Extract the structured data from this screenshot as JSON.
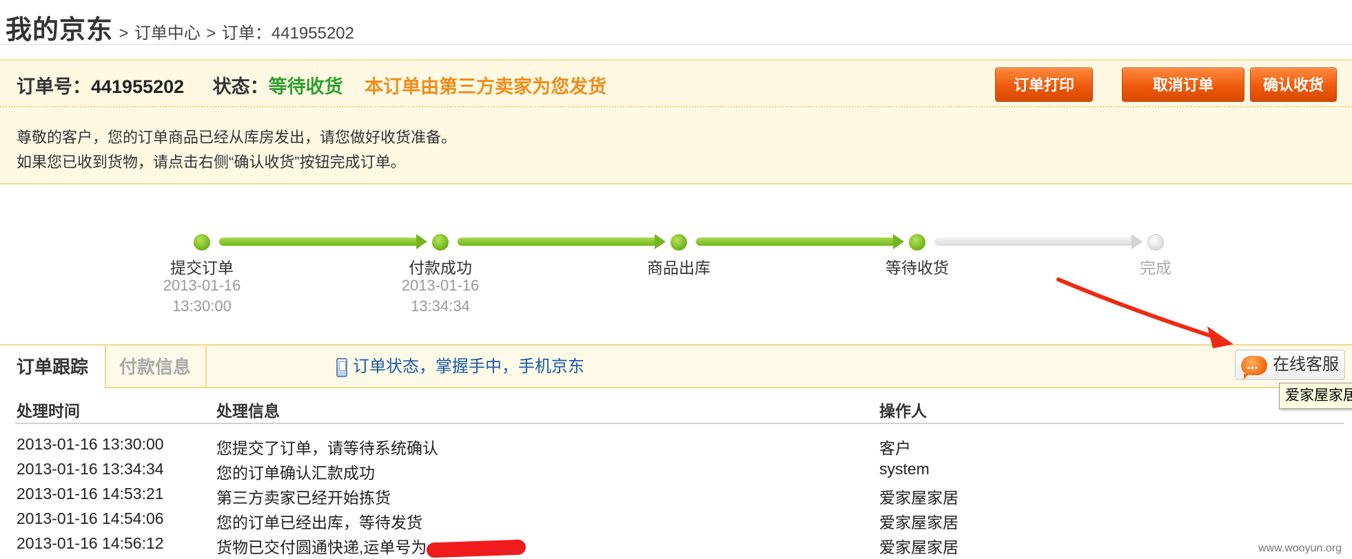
{
  "breadcrumb": {
    "home": "我的京东",
    "separator": ">",
    "level1": "订单中心",
    "level2": "订单：441955202"
  },
  "order": {
    "number_label": "订单号：",
    "number": "441955202",
    "status_label": "状态：",
    "status": "等待收货",
    "shipper_note": "本订单由第三方卖家为您发货",
    "message_line1": "尊敬的客户，您的订单商品已经从库房发出，请您做好收货准备。",
    "message_line2": "如果您已收到货物，请点击右侧“确认收货”按钮完成订单。"
  },
  "actions": {
    "print": "订单打印",
    "cancel": "取消订单",
    "confirm": "确认收货"
  },
  "progress": {
    "steps": [
      {
        "label": "提交订单",
        "date": "2013-01-16",
        "time": "13:30:00",
        "done": true
      },
      {
        "label": "付款成功",
        "date": "2013-01-16",
        "time": "13:34:34",
        "done": true
      },
      {
        "label": "商品出库",
        "done": true
      },
      {
        "label": "等待收货",
        "done": true
      },
      {
        "label": "完成",
        "done": false
      }
    ]
  },
  "tabs": {
    "tracking": "订单跟踪",
    "payment": "付款信息",
    "mobile_link": "订单状态，掌握手中，手机京东",
    "online_service": "在线客服",
    "tooltip": "爱家屋家居"
  },
  "table": {
    "headers": {
      "time": "处理时间",
      "info": "处理信息",
      "operator": "操作人"
    },
    "rows": [
      {
        "time": "2013-01-16 13:30:00",
        "info": "您提交了订单，请等待系统确认",
        "operator": "客户"
      },
      {
        "time": "2013-01-16 13:34:34",
        "info": "您的订单确认汇款成功",
        "operator": "system"
      },
      {
        "time": "2013-01-16 14:53:21",
        "info": "第三方卖家已经开始拣货",
        "operator": "爱家屋家居"
      },
      {
        "time": "2013-01-16 14:54:06",
        "info": "您的订单已经出库，等待发货",
        "operator": "爱家屋家居"
      },
      {
        "time": "2013-01-16 14:56:12",
        "info": "货物已交付圆通快递,运单号为",
        "operator": "爱家屋家居"
      }
    ]
  },
  "watermark": "www.wooyun.org",
  "colors": {
    "accent_orange": "#ee5a0c",
    "status_green": "#2ca02c",
    "note_orange": "#f08c1c",
    "progress_green": "#74b51e",
    "link_blue": "#1a5aa6",
    "annotation_red": "#ee2a14"
  }
}
